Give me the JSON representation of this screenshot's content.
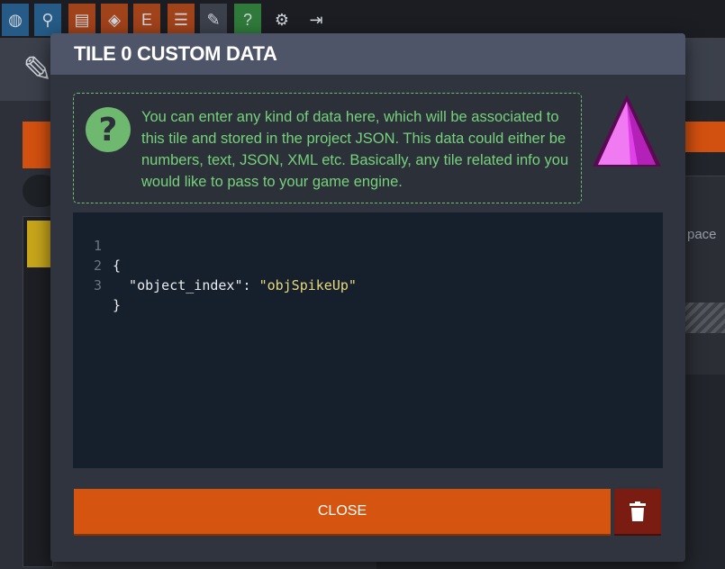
{
  "modal": {
    "title": "TILE 0 CUSTOM DATA",
    "info_icon": "question-circle-icon",
    "info_text": "You can enter any kind of data here, which will be associated to this tile and stored in the project JSON. This data could either be numbers, text, JSON, XML etc. Basically, any tile related info you would like to pass to your game engine.",
    "tile_preview": "spike-tile-icon",
    "editor": {
      "lines": [
        {
          "num": "1",
          "text": "{"
        },
        {
          "num": "2",
          "key": "  \"object_index\": ",
          "value": "\"objSpikeUp\""
        },
        {
          "num": "3",
          "text": "}"
        }
      ]
    },
    "close_label": "CLOSE",
    "delete_icon": "trash-icon"
  },
  "background": {
    "partial_text": "pace",
    "toolbar_icons": [
      "globe-icon",
      "map-pin-icon",
      "folder-settings-icon",
      "layers-icon",
      "entity-icon",
      "list-icon",
      "brush-icon",
      "help-icon",
      "gear-icon",
      "exit-icon"
    ]
  },
  "colors": {
    "accent": "#d5540f",
    "delete": "#7b1c12",
    "info": "#76d17c",
    "tile": "#e040e8"
  }
}
